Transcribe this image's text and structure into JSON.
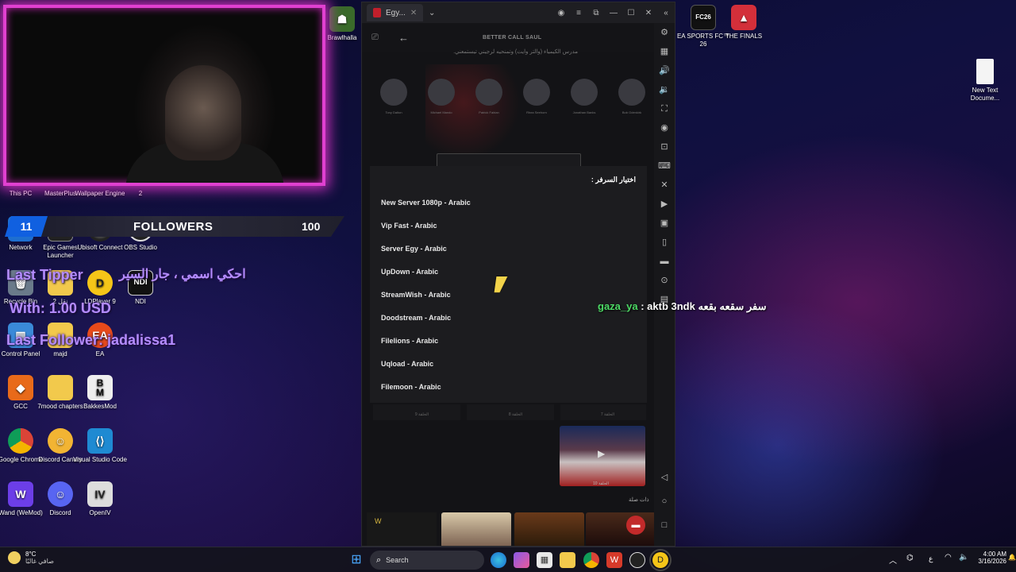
{
  "desktop": {
    "icons": [
      {
        "label": "This PC"
      },
      {
        "label": "MasterPlus"
      },
      {
        "label": "Wallpaper Engine"
      },
      {
        "label": "2"
      },
      {
        "label": "Network"
      },
      {
        "label": "Epic Games Launcher"
      },
      {
        "label": "Ubisoft Connect"
      },
      {
        "label": "OBS Studio"
      },
      {
        "label": "Recycle Bin"
      },
      {
        "label": "نقل 2"
      },
      {
        "label": "LDPlayer 9"
      },
      {
        "label": "NDI"
      },
      {
        "label": "Control Panel"
      },
      {
        "label": "majd"
      },
      {
        "label": "EA"
      },
      {
        "label": "GCC"
      },
      {
        "label": "7mood chapters"
      },
      {
        "label": "BakkesMod"
      },
      {
        "label": "Google Chrome"
      },
      {
        "label": "Discord Canary"
      },
      {
        "label": "Visual Studio Code"
      },
      {
        "label": "Wand (WeMod)"
      },
      {
        "label": "Discord"
      },
      {
        "label": "OpenIV"
      },
      {
        "label": "Brawlhalla"
      },
      {
        "label": "EA SPORTS FC™ 26"
      },
      {
        "label": "THE FINALS"
      },
      {
        "label": "Fi"
      },
      {
        "label": "New Text Docume..."
      }
    ],
    "epic_icon_text": "EPIC GAMES",
    "ndi_icon_text": "NDI",
    "bakkes_icon_text": "B",
    "bakkes_icon_text2": "M",
    "openiv_icon_text": "IV",
    "fc26_icon_text": "FC26"
  },
  "overlay": {
    "counter_value": "11",
    "followers_label": "FOLLOWERS",
    "followers_goal": "100",
    "last_tipper_label": "Last Tipper",
    "last_tipper_msg": "احكي اسمي ، جار السير",
    "tip_amount": "With: 1.00 USD",
    "last_follower": "Last Follower: jadalissa1",
    "chat_user": "gaza_ya",
    "chat_message": ": aktb 3ndk سفر سقعه بقعه"
  },
  "emulator": {
    "tab_title": "Egy...",
    "app_header_title": "BETTER CALL SAUL",
    "arabic_desc": "مدرس الكيمياء (والتر وايت) وتمنحيه لرجيني تيستمعني.",
    "cast": [
      "Tony Dalton",
      "Michael Mando",
      "Patrick Fabian",
      "Rhea Seehorn",
      "Jonathan Banks",
      "Bob Odenkirk"
    ],
    "server_panel_title": "اختيار السرفر :",
    "servers": [
      "New Server 1080p - Arabic",
      "Vip Fast - Arabic",
      "Server Egy - Arabic",
      "UpDown - Arabic",
      "StreamWish - Arabic",
      "Doodstream - Arabic",
      "Filelions - Arabic",
      "Uqload - Arabic",
      "Filemoon - Arabic"
    ],
    "episodes": [
      "الحلقة 9",
      "الحلقة 8",
      "الحلقة 7",
      "الحلقة 10"
    ],
    "related_label": "ذات صلة",
    "sidebar_icons": [
      "settings-icon",
      "keyboard-icon",
      "volume-up-icon",
      "volume-down-icon",
      "fullscreen-icon",
      "record-icon",
      "screenshot-icon",
      "gamepad-icon",
      "close-x-icon",
      "video-icon",
      "apk-icon",
      "phone-icon",
      "folder-icon",
      "location-icon",
      "more-icon"
    ],
    "sidebar_glyphs": [
      "⚙",
      "▦",
      "🔊",
      "🔉",
      "⛶",
      "◉",
      "⊡",
      "⌨",
      "✕",
      "▶",
      "▣",
      "▯",
      "▬",
      "⊙",
      "▤"
    ]
  },
  "taskbar": {
    "weather_temp": "8°C",
    "weather_desc": "صافي غالبًا",
    "search_placeholder": "Search",
    "time": "4:00 AM",
    "date": "3/16/2026",
    "lang": "ع"
  }
}
